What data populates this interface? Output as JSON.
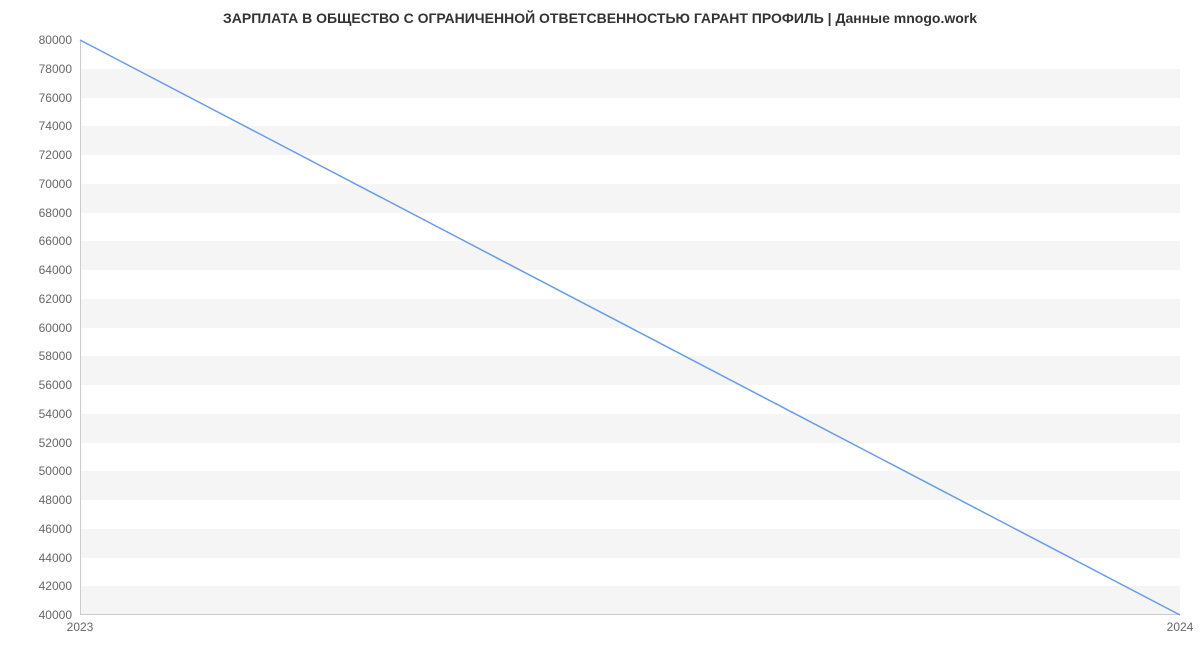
{
  "chart_data": {
    "type": "line",
    "title": "ЗАРПЛАТА В ОБЩЕСТВО С ОГРАНИЧЕННОЙ ОТВЕТСВЕННОСТЬЮ ГАРАНТ ПРОФИЛЬ | Данные mnogo.work",
    "xlabel": "",
    "ylabel": "",
    "x": [
      "2023",
      "2024"
    ],
    "values": [
      80000,
      40000
    ],
    "y_ticks": [
      40000,
      42000,
      44000,
      46000,
      48000,
      50000,
      52000,
      54000,
      56000,
      58000,
      60000,
      62000,
      64000,
      66000,
      68000,
      70000,
      72000,
      74000,
      76000,
      78000,
      80000
    ],
    "x_ticks": [
      "2023",
      "2024"
    ],
    "ylim": [
      40000,
      80000
    ],
    "line_color": "#6a9be8",
    "grid": true
  }
}
